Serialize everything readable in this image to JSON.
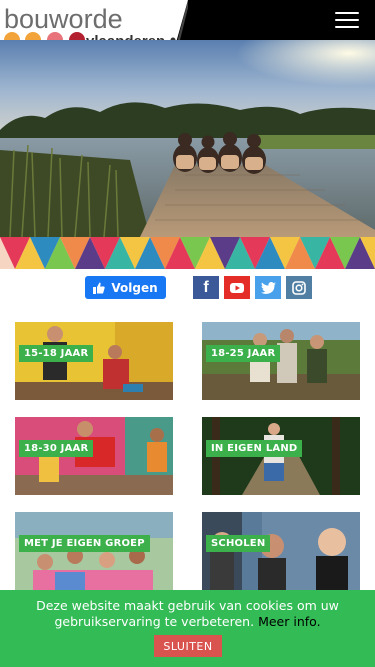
{
  "header": {
    "logo_word1": "bouwo",
    "logo_word2": "rde",
    "logo_sub": "vlaanderen",
    "menu_icon": "hamburger-icon"
  },
  "social": {
    "follow_label": "Volgen",
    "follow_icon": "thumbs-up-icon",
    "buttons": [
      {
        "name": "facebook",
        "icon": "facebook-icon",
        "color": "#3b5998"
      },
      {
        "name": "youtube",
        "icon": "youtube-icon",
        "color": "#e52d27"
      },
      {
        "name": "twitter",
        "icon": "twitter-icon",
        "color": "#4aa1eb"
      },
      {
        "name": "instagram",
        "icon": "instagram-icon",
        "color": "#517fa4"
      }
    ]
  },
  "tiles": [
    {
      "label": "15-18 JAAR"
    },
    {
      "label": "18-25 JAAR"
    },
    {
      "label": "18-30 JAAR"
    },
    {
      "label": "IN EIGEN LAND"
    },
    {
      "label": "MET JE EIGEN GROEP"
    },
    {
      "label": "SCHOLEN"
    }
  ],
  "cookie": {
    "message": "Deze website maakt gebruik van cookies om uw gebruikservaring te verbeteren.",
    "more_link": "Meer info.",
    "close_label": "SLUITEN"
  },
  "colors": {
    "accent_green": "#3bb04b",
    "cookie_bg": "#33bb55",
    "close_red": "#d9534f",
    "follow_blue": "#1877f2"
  }
}
